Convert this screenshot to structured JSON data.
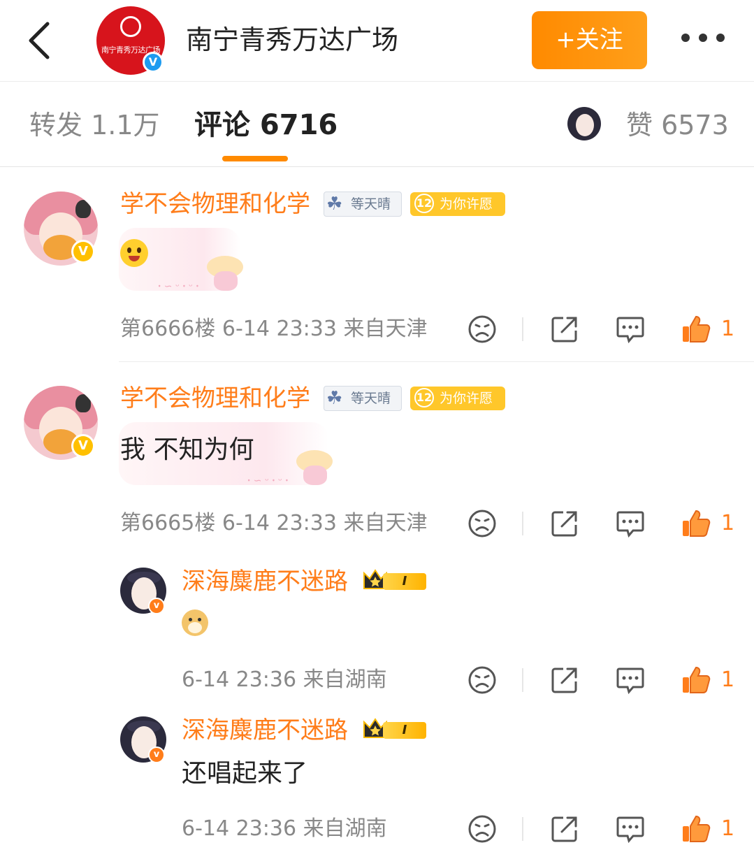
{
  "header": {
    "account_name": "南宁青秀万达广场",
    "avatar_logo_text": "南宁青秀万达广场",
    "verified_mark": "V",
    "follow_label": "+关注"
  },
  "tabs": {
    "repost": "转发 1.1万",
    "comment": "评论 6716",
    "like": "赞 6573"
  },
  "colors": {
    "accent": "#ff7d1a",
    "follow_bg": "#ff8a00",
    "verified": "#1d9bf0"
  },
  "comments": [
    {
      "username": "学不会物理和化学",
      "weather_tag": "等天晴",
      "wish_level": "12",
      "wish_tag": "为你许愿",
      "content_emoji": "laughing-face-emoji",
      "meta": "第6666楼  6-14 23:33  来自天津",
      "likes": "1",
      "verified_mark": "V"
    },
    {
      "username": "学不会物理和化学",
      "weather_tag": "等天晴",
      "wish_level": "12",
      "wish_tag": "为你许愿",
      "text": "我 不知为何",
      "meta": "第6665楼  6-14 23:33  来自天津",
      "likes": "1",
      "verified_mark": "V",
      "replies": [
        {
          "username": "深海麋鹿不迷路",
          "level_badge": "I",
          "content_emoji": "doge-emoji",
          "meta": "6-14 23:36  来自湖南",
          "likes": "1",
          "verified_mark": "v"
        },
        {
          "username": "深海麋鹿不迷路",
          "level_badge": "I",
          "text": "还唱起来了",
          "meta": "6-14 23:36  来自湖南",
          "likes": "1",
          "verified_mark": "v"
        }
      ]
    }
  ]
}
